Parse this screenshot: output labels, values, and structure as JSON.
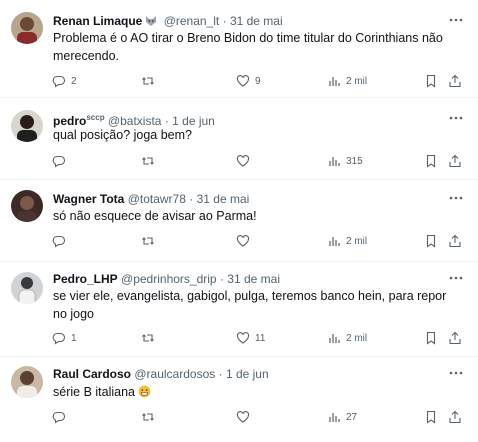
{
  "tweets": [
    {
      "name": "Renan Limaque",
      "name_badge": "",
      "has_wolf_emoji": true,
      "handle": "@renan_lt",
      "date": "31 de mai",
      "text": "Problema é o AO tirar o Breno Bidon do time titular do Corinthians não merecendo.",
      "replies": "2",
      "retweets": "",
      "likes": "9",
      "views": "2 mil"
    },
    {
      "name": "pedro",
      "name_badge": "sccp",
      "has_wolf_emoji": false,
      "handle": "@batxista",
      "date": "1 de jun",
      "text": "qual posição? joga bem?",
      "replies": "",
      "retweets": "",
      "likes": "",
      "views": "315"
    },
    {
      "name": "Wagner Tota",
      "name_badge": "",
      "has_wolf_emoji": false,
      "handle": "@totawr78",
      "date": "31 de mai",
      "text": "só não esquece de avisar ao Parma!",
      "replies": "",
      "retweets": "",
      "likes": "",
      "views": "2 mil"
    },
    {
      "name": "Pedro_LHP",
      "name_badge": "",
      "has_wolf_emoji": false,
      "handle": "@pedrinhors_drip",
      "date": "31 de mai",
      "text": "se vier ele, evangelista, gabigol, pulga, teremos banco hein, para repor no jogo",
      "replies": "1",
      "retweets": "",
      "likes": "11",
      "views": "2 mil"
    },
    {
      "name": "Raul Cardoso",
      "name_badge": "",
      "has_wolf_emoji": false,
      "handle": "@raulcardosos",
      "date": "1 de jun",
      "text": "série B italiana",
      "replies": "",
      "retweets": "",
      "likes": "",
      "views": "27"
    }
  ],
  "separator": "·",
  "icons": {
    "more": "more-dots-icon",
    "reply": "reply-icon",
    "retweet": "retweet-icon",
    "like": "heart-icon",
    "views": "views-chart-icon",
    "bookmark": "bookmark-icon",
    "share": "share-icon",
    "emoji_wolf": "wolf-emoji",
    "emoji_smile": "grin-emoji"
  },
  "colors": {
    "text": "#0f1419",
    "muted": "#536471",
    "divider": "#eff3f4"
  }
}
